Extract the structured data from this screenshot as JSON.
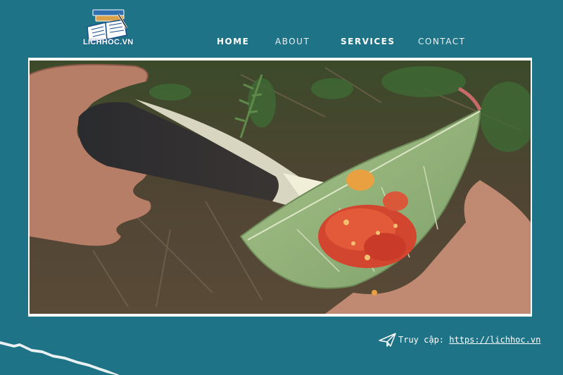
{
  "brand": {
    "logo_text": "LICHHOC.VN"
  },
  "nav": {
    "items": [
      {
        "label": "HOME"
      },
      {
        "label": "ABOUT"
      },
      {
        "label": "SERVICES"
      },
      {
        "label": "CONTACT"
      }
    ]
  },
  "footer": {
    "prefix": "Truy cập: ",
    "url": "https://lichhoc.vn"
  },
  "colors": {
    "background": "#1f7386",
    "frame": "#ffffff",
    "nav_text": "#ffffff"
  },
  "icons": {
    "logo": "open-book-icon",
    "footer": "paper-plane-icon"
  }
}
